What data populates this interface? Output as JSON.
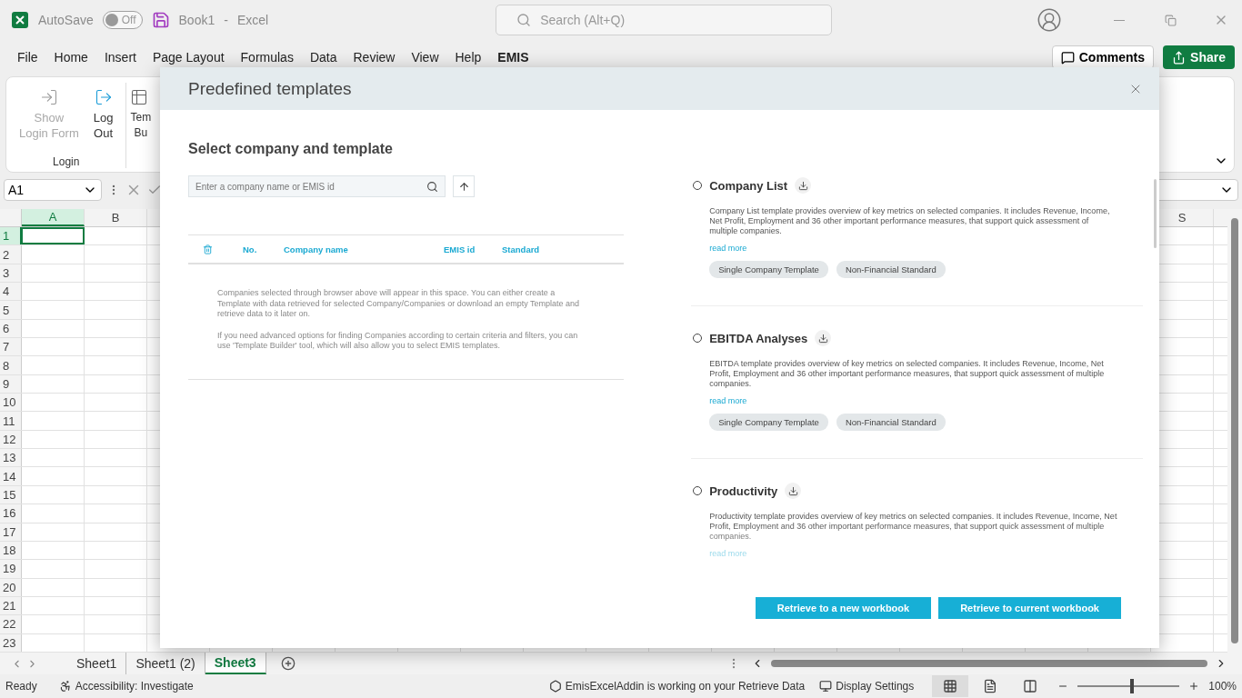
{
  "title_bar": {
    "autosave": {
      "label": "AutoSave",
      "on": false,
      "state_text": "Off"
    },
    "document": "Book1",
    "separator": "-",
    "app": "Excel",
    "search": {
      "placeholder": "Search (Alt+Q)"
    }
  },
  "menu": {
    "tabs": [
      {
        "label": "File",
        "selected": false
      },
      {
        "label": "Home",
        "selected": false
      },
      {
        "label": "Insert",
        "selected": false
      },
      {
        "label": "Page Layout",
        "selected": false
      },
      {
        "label": "Formulas",
        "selected": false
      },
      {
        "label": "Data",
        "selected": false
      },
      {
        "label": "Review",
        "selected": false
      },
      {
        "label": "View",
        "selected": false
      },
      {
        "label": "Help",
        "selected": false
      },
      {
        "label": "EMIS",
        "selected": true
      }
    ],
    "comments": "Comments",
    "share": "Share"
  },
  "ribbon": {
    "buttons": [
      {
        "kind": "login",
        "lines": [
          "Show",
          "Login Form"
        ],
        "disabled": true
      },
      {
        "kind": "logout",
        "lines": [
          "Log",
          "Out"
        ],
        "disabled": false
      },
      {
        "kind": "builder",
        "lines": [
          "Tem",
          "Bu"
        ],
        "disabled": false
      }
    ],
    "group_label": "Login"
  },
  "formula_bar": {
    "name_box": "A1"
  },
  "grid": {
    "left_columns": [
      {
        "label": "A",
        "selected": true
      },
      {
        "label": "B",
        "selected": false
      }
    ],
    "right_columns": [
      {
        "label": "S",
        "selected": false
      }
    ],
    "rows": [
      {
        "label": "1",
        "selected": true
      },
      {
        "label": "2",
        "selected": false
      },
      {
        "label": "3",
        "selected": false
      },
      {
        "label": "4",
        "selected": false
      },
      {
        "label": "5",
        "selected": false
      },
      {
        "label": "6",
        "selected": false
      },
      {
        "label": "7",
        "selected": false
      },
      {
        "label": "8",
        "selected": false
      },
      {
        "label": "9",
        "selected": false
      },
      {
        "label": "10",
        "selected": false
      },
      {
        "label": "11",
        "selected": false
      },
      {
        "label": "12",
        "selected": false
      },
      {
        "label": "13",
        "selected": false
      },
      {
        "label": "14",
        "selected": false
      },
      {
        "label": "15",
        "selected": false
      },
      {
        "label": "16",
        "selected": false
      },
      {
        "label": "17",
        "selected": false
      },
      {
        "label": "18",
        "selected": false
      },
      {
        "label": "19",
        "selected": false
      },
      {
        "label": "20",
        "selected": false
      },
      {
        "label": "21",
        "selected": false
      },
      {
        "label": "22",
        "selected": false
      },
      {
        "label": "23",
        "selected": false
      }
    ]
  },
  "sheets": [
    {
      "label": "Sheet1",
      "selected": false
    },
    {
      "label": "Sheet1 (2)",
      "selected": false
    },
    {
      "label": "Sheet3",
      "selected": true
    }
  ],
  "status_bar": {
    "ready": "Ready",
    "accessibility": "Accessibility: Investigate",
    "addin": "EmisExcelAddin is working on your Retrieve Data",
    "display_settings": "Display Settings",
    "views": [
      {
        "kind": "normal",
        "selected": true
      },
      {
        "kind": "page_layout",
        "selected": false
      },
      {
        "kind": "page_break",
        "selected": false
      }
    ],
    "zoom": {
      "level": 0.53,
      "reading": "100%"
    }
  },
  "dialog": {
    "title": "Predefined templates",
    "heading": "Select company and template",
    "search": {
      "placeholder": "Enter a company name or EMIS id"
    },
    "table": {
      "columns": [
        "No.",
        "Company name",
        "EMIS id",
        "Standard"
      ]
    },
    "empty_text": [
      "Companies selected through browser above will appear in this space. You can either create a Template with data retrieved for selected Company/Companies or download an empty Template and retrieve data to it later on.",
      "If you need advanced options for finding Companies according to certain criteria and filters, you can use 'Template Builder' tool, which will also allow you to select EMIS templates."
    ],
    "templates": [
      {
        "name": "Company List",
        "selected": false,
        "description": "Company List template provides overview of key metrics on selected companies. It includes Revenue, Income, Net Profit, Employment and 36 other important performance measures, that support quick assessment of multiple companies.",
        "read_more": "read more",
        "tags": [
          "Single Company Template",
          "Non-Financial Standard"
        ]
      },
      {
        "name": "EBITDA Analyses",
        "selected": false,
        "description": "EBITDA template provides overview of key metrics on selected companies. It includes Revenue, Income, Net Profit, Employment and 36 other important performance measures, that support quick assessment of multiple companies.",
        "read_more": "read more",
        "tags": [
          "Single Company Template",
          "Non-Financial Standard"
        ]
      },
      {
        "name": "Productivity",
        "selected": false,
        "description": "Productivity template provides overview of key metrics on selected companies. It includes Revenue, Income, Net Profit, Employment and 36 other important performance measures, that support quick assessment of multiple companies.",
        "read_more": "read more"
      }
    ],
    "buttons": [
      "Retrieve to a new workbook",
      "Retrieve to current workbook"
    ]
  }
}
